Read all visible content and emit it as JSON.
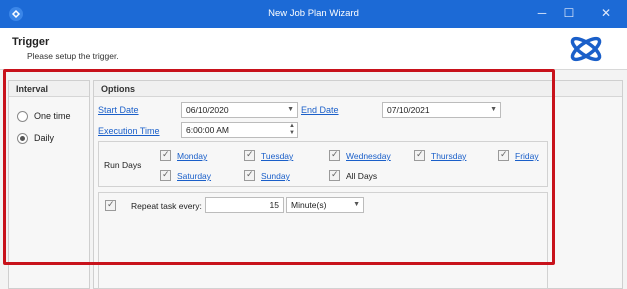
{
  "window": {
    "title": "New Job Plan Wizard",
    "titlebar_color": "#1c6ad6",
    "controls": [
      "─",
      "☐",
      "✕"
    ]
  },
  "header": {
    "title": "Trigger",
    "subtitle": "Please setup the trigger."
  },
  "interval": {
    "heading": "Interval",
    "options": [
      {
        "label": "One time",
        "checked": false
      },
      {
        "label": "Daily",
        "checked": true
      }
    ]
  },
  "options": {
    "heading": "Options",
    "start_date_label": "Start Date",
    "start_date_value": "06/10/2020",
    "end_date_label": "End Date",
    "end_date_value": "07/10/2021",
    "execution_time_label": "Execution Time",
    "execution_time_value": "6:00:00 AM",
    "run_days_label": "Run Days",
    "days": [
      {
        "label": "Monday",
        "checked": true
      },
      {
        "label": "Tuesday",
        "checked": true
      },
      {
        "label": "Wednesday",
        "checked": true
      },
      {
        "label": "Thursday",
        "checked": true
      },
      {
        "label": "Friday",
        "checked": true
      },
      {
        "label": "Saturday",
        "checked": true
      },
      {
        "label": "Sunday",
        "checked": true
      },
      {
        "label": "All Days",
        "checked": true
      }
    ],
    "repeat_label": "Repeat task every:",
    "repeat_checked": true,
    "repeat_value": "15",
    "repeat_unit": "Minute(s)"
  },
  "highlight_color": "#c8121b"
}
